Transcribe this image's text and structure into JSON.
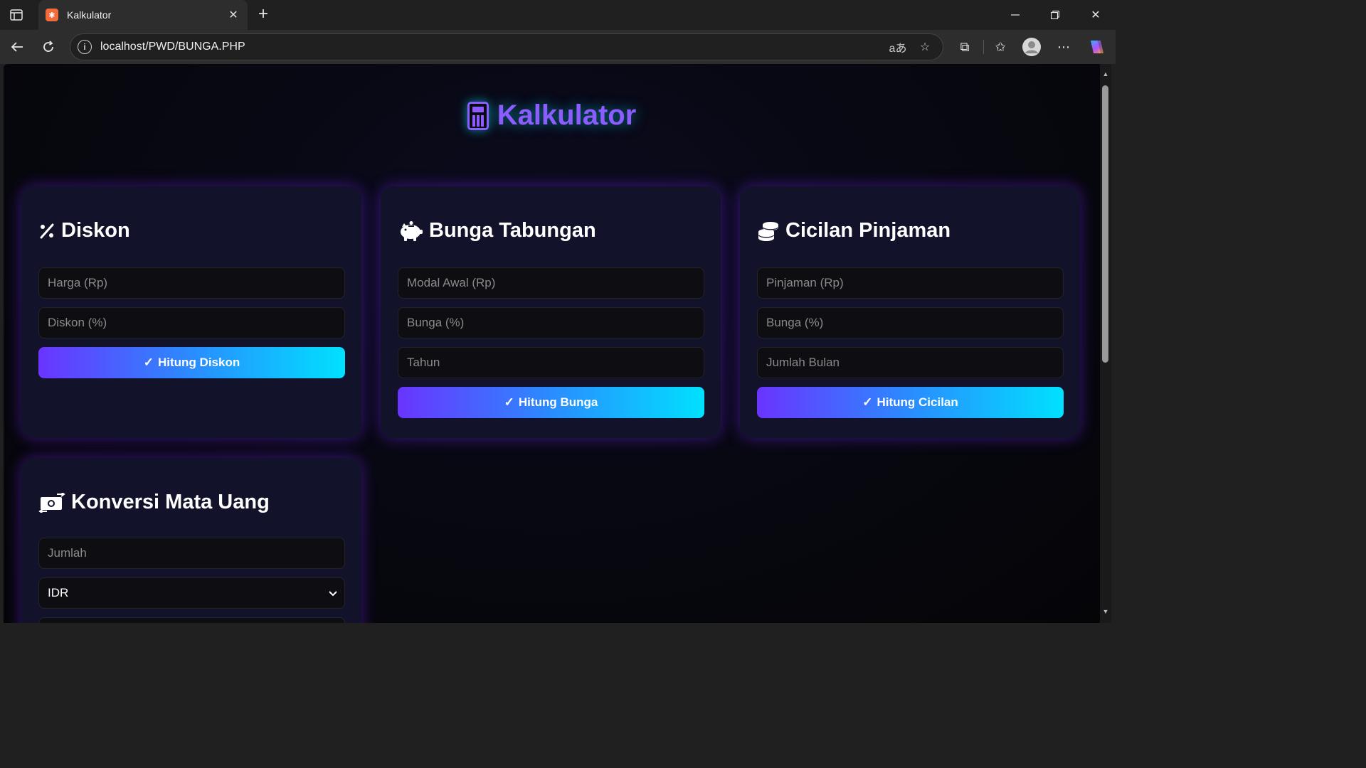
{
  "browser": {
    "tab_title": "Kalkulator",
    "url": "localhost/PWD/BUNGA.PHP",
    "favicon_text": "✱",
    "translate_icon_text": "aあ"
  },
  "page": {
    "title": "Kalkulator",
    "accent_color": "#8d5cff",
    "glow_color": "#00e1ff"
  },
  "cards": {
    "diskon": {
      "title": "Diskon",
      "icon": "percent-icon",
      "fields": [
        "Harga (Rp)",
        "Diskon (%)"
      ],
      "button": "Hitung Diskon"
    },
    "bunga": {
      "title": "Bunga Tabungan",
      "icon": "piggy-bank-icon",
      "fields": [
        "Modal Awal (Rp)",
        "Bunga (%)",
        "Tahun"
      ],
      "button": "Hitung Bunga"
    },
    "cicilan": {
      "title": "Cicilan Pinjaman",
      "icon": "coins-icon",
      "fields": [
        "Pinjaman (Rp)",
        "Bunga (%)",
        "Jumlah Bulan"
      ],
      "button": "Hitung Cicilan"
    },
    "konversi": {
      "title": "Konversi Mata Uang",
      "icon": "money-exchange-icon",
      "fields": [
        "Jumlah"
      ],
      "select_value": "IDR"
    }
  }
}
